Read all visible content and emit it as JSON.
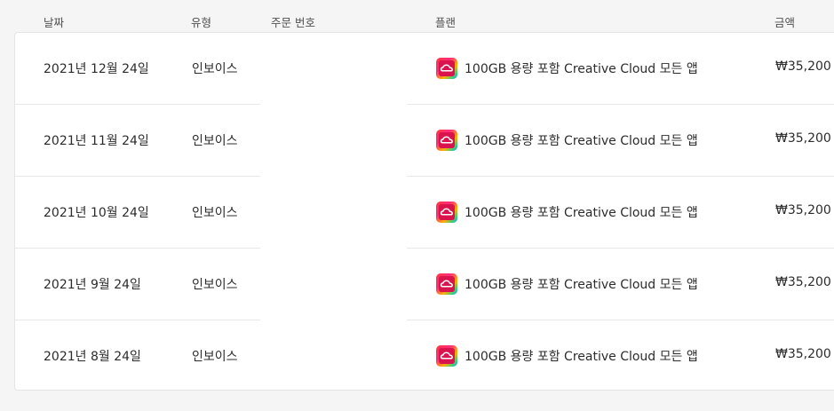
{
  "columns": {
    "date": "날짜",
    "type": "유형",
    "order": "주문 번호",
    "plan": "플랜",
    "amount": "금액"
  },
  "rows": [
    {
      "date": "2021년 12월 24일",
      "type": "인보이스",
      "plan": "100GB 용량 포함 Creative Cloud 모든 앱",
      "amount": "₩35,200"
    },
    {
      "date": "2021년 11월 24일",
      "type": "인보이스",
      "plan": "100GB 용량 포함 Creative Cloud 모든 앱",
      "amount": "₩35,200"
    },
    {
      "date": "2021년 10월 24일",
      "type": "인보이스",
      "plan": "100GB 용량 포함 Creative Cloud 모든 앱",
      "amount": "₩35,200"
    },
    {
      "date": "2021년 9월 24일",
      "type": "인보이스",
      "plan": "100GB 용량 포함 Creative Cloud 모든 앱",
      "amount": "₩35,200"
    },
    {
      "date": "2021년 8월 24일",
      "type": "인보이스",
      "plan": "100GB 용량 포함 Creative Cloud 모든 앱",
      "amount": "₩35,200"
    }
  ],
  "icons": {
    "plan_icon": "creative-cloud-icon"
  },
  "colors": {
    "background": "#f5f5f5",
    "card": "#ffffff",
    "divider": "#e8e8e8"
  }
}
